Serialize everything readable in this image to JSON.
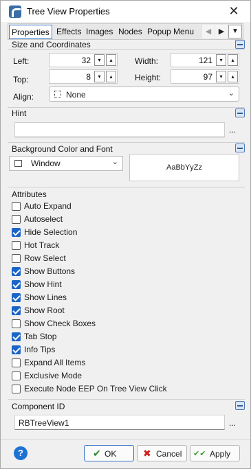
{
  "window": {
    "title": "Tree View Properties",
    "close_glyph": "✕",
    "icon": "app-tree-icon"
  },
  "tabs": {
    "items": [
      "Properties",
      "Effects",
      "Images",
      "Nodes",
      "Popup Menu"
    ],
    "active": "Properties",
    "scroll_left_glyph": "◀",
    "scroll_right_glyph": "▶",
    "more_glyph": "▼"
  },
  "size_coords": {
    "title": "Size and Coordinates",
    "left_label": "Left:",
    "left_value": "32",
    "top_label": "Top:",
    "top_value": "8",
    "width_label": "Width:",
    "width_value": "121",
    "height_label": "Height:",
    "height_value": "97",
    "align_label": "Align:",
    "align_value": "None",
    "down_glyph": "▾",
    "up_glyph": "▴"
  },
  "hint": {
    "title": "Hint",
    "value": "",
    "browse_label": "..."
  },
  "background": {
    "title": "Background Color and Font",
    "color_value": "Window",
    "color_arrow": "⌄",
    "font_preview": "AaBbYyZz"
  },
  "attributes": {
    "title": "Attributes",
    "items": [
      {
        "label": "Auto Expand",
        "checked": false
      },
      {
        "label": "Autoselect",
        "checked": false
      },
      {
        "label": "Hide Selection",
        "checked": true
      },
      {
        "label": "Hot Track",
        "checked": false
      },
      {
        "label": "Row Select",
        "checked": false
      },
      {
        "label": "Show Buttons",
        "checked": true
      },
      {
        "label": "Show Hint",
        "checked": true
      },
      {
        "label": "Show Lines",
        "checked": true
      },
      {
        "label": "Show Root",
        "checked": true
      },
      {
        "label": "Show Check Boxes",
        "checked": false
      },
      {
        "label": "Tab Stop",
        "checked": true
      },
      {
        "label": "Info Tips",
        "checked": true
      },
      {
        "label": "Expand All Items",
        "checked": false
      },
      {
        "label": "Exclusive Mode",
        "checked": false
      },
      {
        "label": "Execute Node EEP On Tree View Click",
        "checked": false
      }
    ]
  },
  "component": {
    "title": "Component ID",
    "value": "RBTreeView1",
    "browse_label": "..."
  },
  "footer": {
    "help_glyph": "?",
    "ok_label": "OK",
    "ok_glyph": "✔",
    "cancel_label": "Cancel",
    "cancel_glyph": "✖",
    "apply_label": "Apply",
    "apply_glyph": "✔✔"
  },
  "colors": {
    "accent": "#1a64c8",
    "ok_check": "#2a8a2a",
    "cancel_x": "#d01c1c",
    "apply_check": "#3a9a2a"
  }
}
